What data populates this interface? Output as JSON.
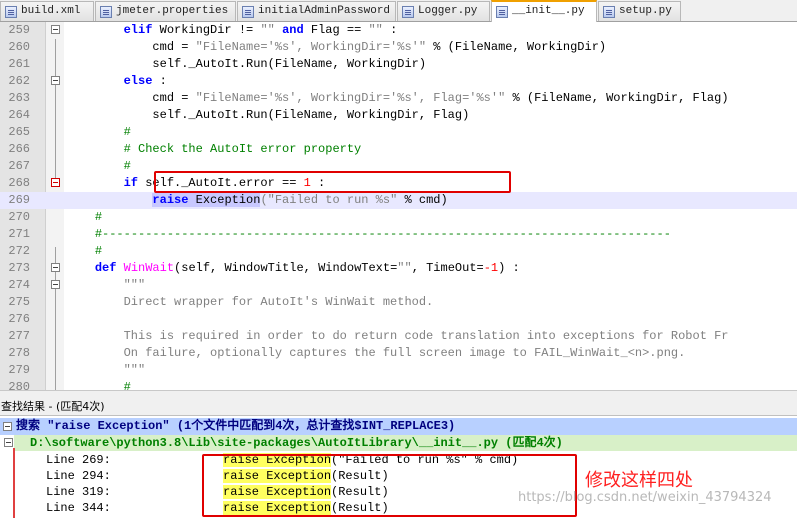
{
  "tabs": [
    {
      "label": "build.xml",
      "active": false
    },
    {
      "label": "jmeter.properties",
      "active": false
    },
    {
      "label": "initialAdminPassword",
      "active": false
    },
    {
      "label": "Logger.py",
      "active": false
    },
    {
      "label": "__init__.py",
      "active": true
    },
    {
      "label": "setup.py",
      "active": false
    }
  ],
  "editor": {
    "line_numbers": [
      "259",
      "260",
      "261",
      "262",
      "263",
      "264",
      "265",
      "266",
      "267",
      "268",
      "269",
      "270",
      "271",
      "272",
      "273",
      "274",
      "275",
      "276",
      "277",
      "278",
      "279",
      "280"
    ]
  },
  "results_panel": {
    "title": "查找结果 - (匹配4次)",
    "search_header": "搜索 \"raise Exception\" (1个文件中匹配到4次，总计查找$INT_REPLACE3)",
    "file_entry": "D:\\software\\python3.8\\Lib\\site-packages\\AutoItLibrary\\__init__.py (匹配4次)",
    "hits": [
      {
        "label": "Line 269:",
        "match": "raise Exception",
        "rest": "(\"Failed to run %s\" % cmd)"
      },
      {
        "label": "Line 294:",
        "match": "raise Exception",
        "rest": "(Result)"
      },
      {
        "label": "Line 319:",
        "match": "raise Exception",
        "rest": "(Result)"
      },
      {
        "label": "Line 344:",
        "match": "raise Exception",
        "rest": "(Result)"
      }
    ]
  },
  "annotation": "修改这样四处",
  "watermark": "https://blog.csdn.net/weixin_43794324",
  "colors": {
    "annotation": "#ff2020",
    "highlight_box": "#e00000",
    "match_highlight": "#ffff60",
    "keyword": "#0000ff",
    "string": "#808080",
    "comment": "#008000"
  }
}
